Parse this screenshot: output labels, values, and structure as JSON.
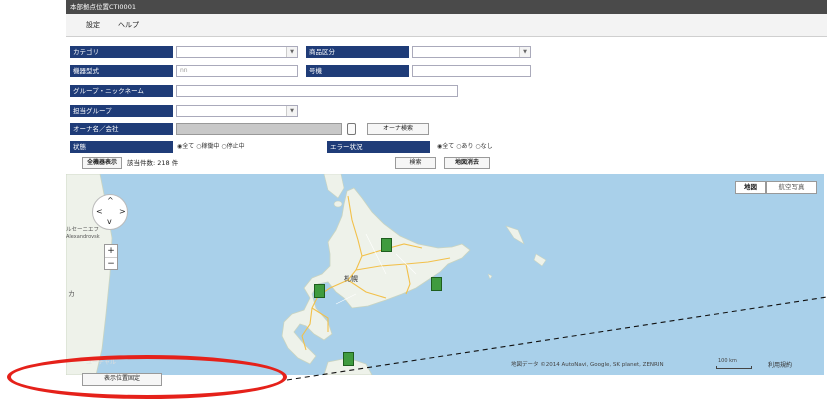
{
  "window": {
    "title": "本部拠点位置CTI0001"
  },
  "menu": {
    "settings": "設定",
    "help": "ヘルプ"
  },
  "form": {
    "category_label": "カテゴリ",
    "product_class_label": "商品区分",
    "device_model_label": "機器型式",
    "device_model_placeholder": "nn",
    "serial_label": "号機",
    "group_nickname_label": "グループ・ニックネーム",
    "group_in_charge_label": "担当グループ",
    "owner_label": "オーナ名／会社",
    "owner_search_button": "オーナ検索",
    "status_label": "状態",
    "status_options": [
      "全て",
      "稼働中",
      "停止中"
    ],
    "error_label": "エラー状況",
    "error_options": [
      "全て",
      "あり",
      "なし"
    ]
  },
  "toolbar": {
    "show_all_button": "全機器表示",
    "result_count": "該当件数: 218 件",
    "search_button": "検索",
    "clear_map_button": "地図消去"
  },
  "map": {
    "type_map": "地図",
    "type_aerial": "航空写真",
    "place_sapporo": "札幌",
    "place_left_1": "ルセーニエフ",
    "place_left_2": "Alexandrovsk",
    "place_left_3": "カ",
    "attribution": "地図データ ©2014 AutoNavi, Google, SK planet, ZENRIN",
    "scale": "100 km",
    "terms": "利用規約",
    "zoom_in": "+",
    "zoom_out": "−"
  },
  "footer": {
    "fix_position_button": "表示位置固定",
    "faint_text": "ユーチャル"
  },
  "colors": {
    "label_bg": "#1f3c78",
    "titlebar_bg": "#4a4a4a",
    "sea": "#a9d0ea",
    "land": "#eef2ea",
    "road": "#f2c04a",
    "marker": "#3f9b3f",
    "highlight_oval": "#e5211a"
  }
}
